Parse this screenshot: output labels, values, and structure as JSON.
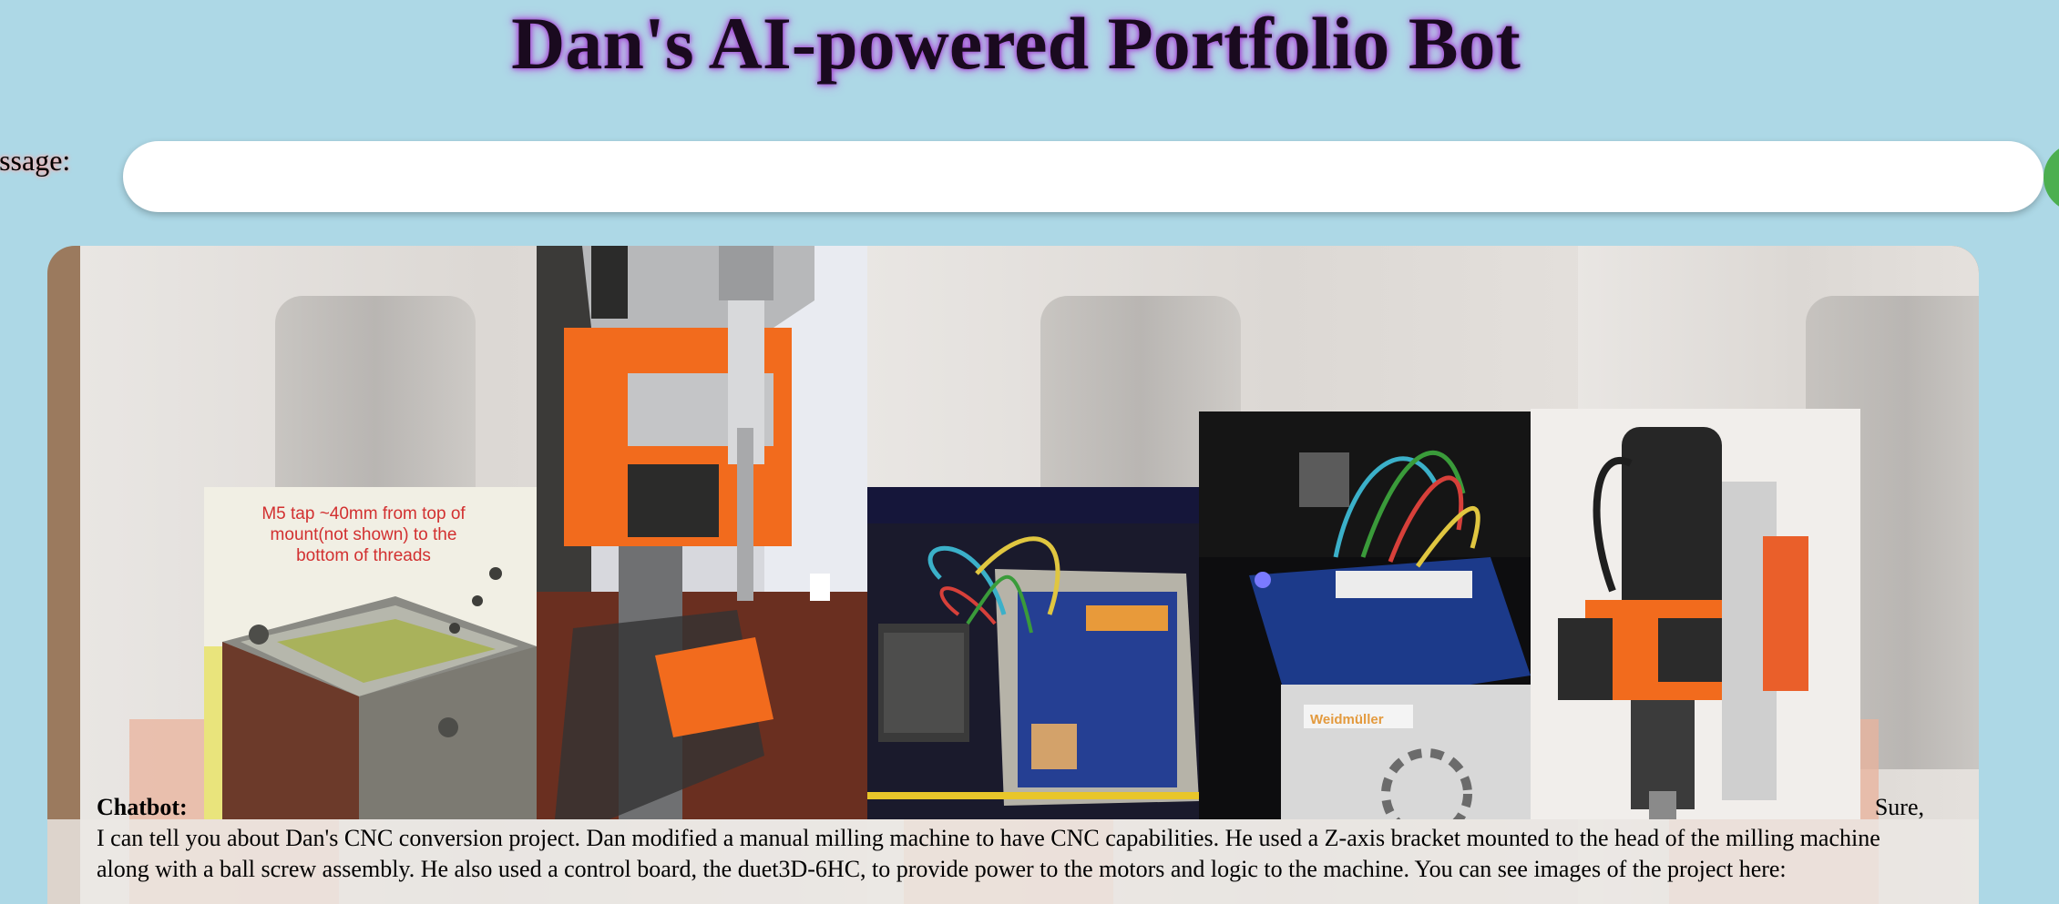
{
  "page": {
    "title": "Dan's AI-powered Portfolio Bot"
  },
  "message_form": {
    "label": "message:",
    "input_value": "",
    "input_placeholder": ""
  },
  "chat": {
    "speaker": "Chatbot:",
    "first_word": "Sure,",
    "body": "I can tell you about Dan's CNC conversion project. Dan modified a manual milling machine to have CNC capabilities. He used a Z-axis bracket mounted to the head of the milling machine along with a ball screw assembly. He also used a control board, the duet3D-6HC, to provide power to the motors and logic to the machine. You can see images of the project here:"
  },
  "gallery": {
    "bracket_caption": "M5 tap ~40mm from top of mount(not shown) to the bottom of threads",
    "psu_label": "Weidmüller"
  },
  "colors": {
    "background": "#add8e6",
    "title_glow": "#a24bd3",
    "send_button": "#4caf50",
    "caption_red": "#d23030",
    "machine_orange": "#f26b1d"
  }
}
